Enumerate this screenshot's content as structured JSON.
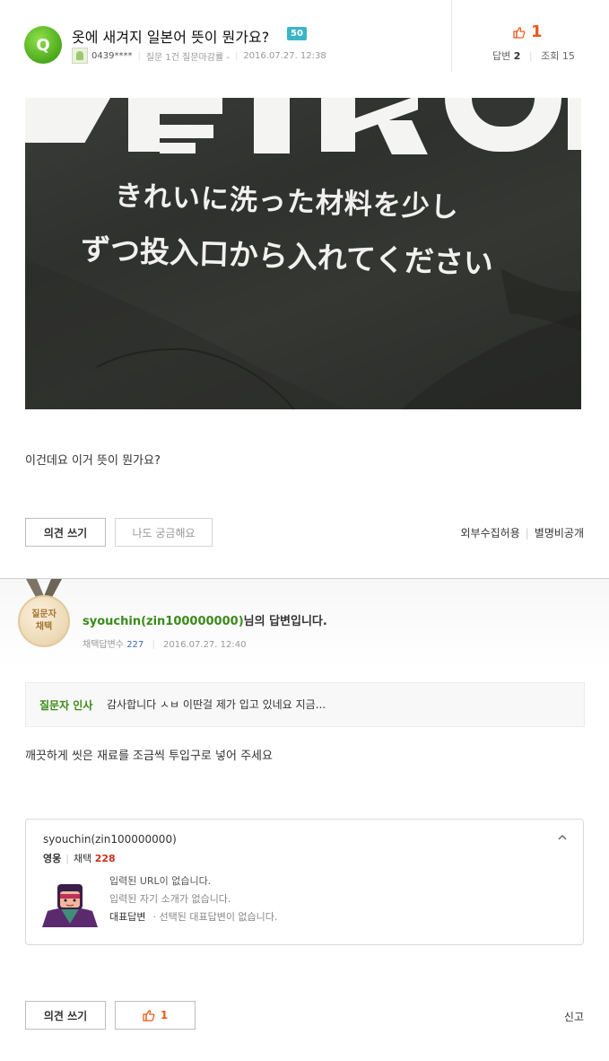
{
  "question": {
    "badge": "Q",
    "title": "옷에 새겨지 일본어 뜻이 뭔가요?",
    "points": "50",
    "user_id": "0439****",
    "user_stats": "질문 1건 질문마감률 -",
    "date": "2016.07.27. 12:38",
    "likes": "1",
    "answers_label": "답변",
    "answers_count": "2",
    "views_label": "조회",
    "views_count": "15",
    "body": "이건데요 이거 뜻이 뭔가요?",
    "photo": {
      "logo_text": "KEIKO",
      "line1": "きれいに洗った材料を少し",
      "line2": "ずつ投入口から入れてください"
    }
  },
  "actions": {
    "write_opinion": "의견 쓰기",
    "me_too": "나도 궁금해요",
    "external_allowed": "외부수집허용",
    "anonymous": "별명비공개",
    "report": "신고",
    "answer_likes": "1"
  },
  "answer": {
    "medal_line1": "질문자",
    "medal_line2": "채택",
    "author": "syouchin(zin100000000)",
    "title_suffix": "님의 답변입니다.",
    "adopted_label": "채택답변수",
    "adopted_count": "227",
    "date": "2016.07.27. 12:40",
    "thanks_label": "질문자 인사",
    "thanks_text": "감사합니다 ㅅㅂ 이딴걸 제가 입고 있네요 지금...",
    "body": "깨끗하게 씻은 재료를 조금씩 투입구로 넣어 주세요"
  },
  "profile": {
    "name": "syouchin(zin100000000)",
    "grade": "영웅",
    "adopt_label": "채택",
    "adopt_count": "228",
    "url_line": "입력된 URL이 없습니다.",
    "intro_line": "입력된 자기 소개가 없습니다.",
    "rep_label": "대표답변",
    "rep_text": "· 선택된 대표답변이 없습니다."
  },
  "colors": {
    "accent_green": "#3b8a1a",
    "like_orange": "#ea5a1e",
    "point_badge": "#3ab5c8"
  },
  "icons": [
    "q-badge",
    "thumbs-up-icon",
    "chevron-up-icon",
    "user-thumb-icon",
    "medal-icon",
    "avatar"
  ]
}
